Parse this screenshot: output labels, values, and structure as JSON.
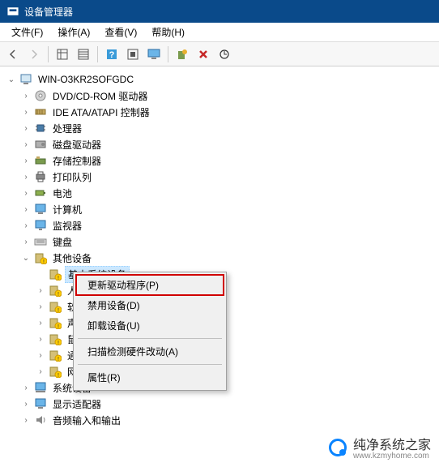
{
  "titlebar": {
    "title": "设备管理器"
  },
  "menubar": {
    "file": "文件(F)",
    "action": "操作(A)",
    "view": "查看(V)",
    "help": "帮助(H)"
  },
  "toolbar": {
    "back": "←",
    "forward": "→",
    "b1": "▦",
    "b2": "▤",
    "b3": "?",
    "b4": "▣",
    "b5": "🖵",
    "b6": "⚙",
    "b7": "✖",
    "b8": "⊙"
  },
  "tree": {
    "root": "WIN-O3KR2SOFGDC",
    "nodes": [
      {
        "label": "DVD/CD-ROM 驱动器",
        "icon": "disc"
      },
      {
        "label": "IDE ATA/ATAPI 控制器",
        "icon": "ide"
      },
      {
        "label": "处理器",
        "icon": "cpu"
      },
      {
        "label": "磁盘驱动器",
        "icon": "disk"
      },
      {
        "label": "存储控制器",
        "icon": "storage"
      },
      {
        "label": "打印队列",
        "icon": "printer"
      },
      {
        "label": "电池",
        "icon": "battery"
      },
      {
        "label": "计算机",
        "icon": "computer"
      },
      {
        "label": "监视器",
        "icon": "monitor"
      },
      {
        "label": "键盘",
        "icon": "keyboard"
      }
    ],
    "other_devices_label": "其他设备",
    "other_children": [
      {
        "label": "基本系统设备",
        "truncated": true
      },
      {
        "label": "人",
        "truncated": true
      },
      {
        "label": "软",
        "truncated": true
      },
      {
        "label": "声",
        "truncated": true
      },
      {
        "label": "鼠",
        "truncated": true
      },
      {
        "label": "通",
        "truncated": true
      },
      {
        "label": "网",
        "truncated": true
      }
    ],
    "tail_nodes": [
      {
        "label": "系统设备",
        "icon": "system"
      },
      {
        "label": "显示适配器",
        "icon": "display"
      },
      {
        "label": "音频输入和输出",
        "icon": "audio"
      }
    ]
  },
  "context_menu": {
    "update": "更新驱动程序(P)",
    "disable": "禁用设备(D)",
    "uninstall": "卸载设备(U)",
    "scan": "扫描检测硬件改动(A)",
    "properties": "属性(R)"
  },
  "watermark": {
    "brand": "纯净系统之家",
    "url": "www.kzmyhome.com"
  }
}
